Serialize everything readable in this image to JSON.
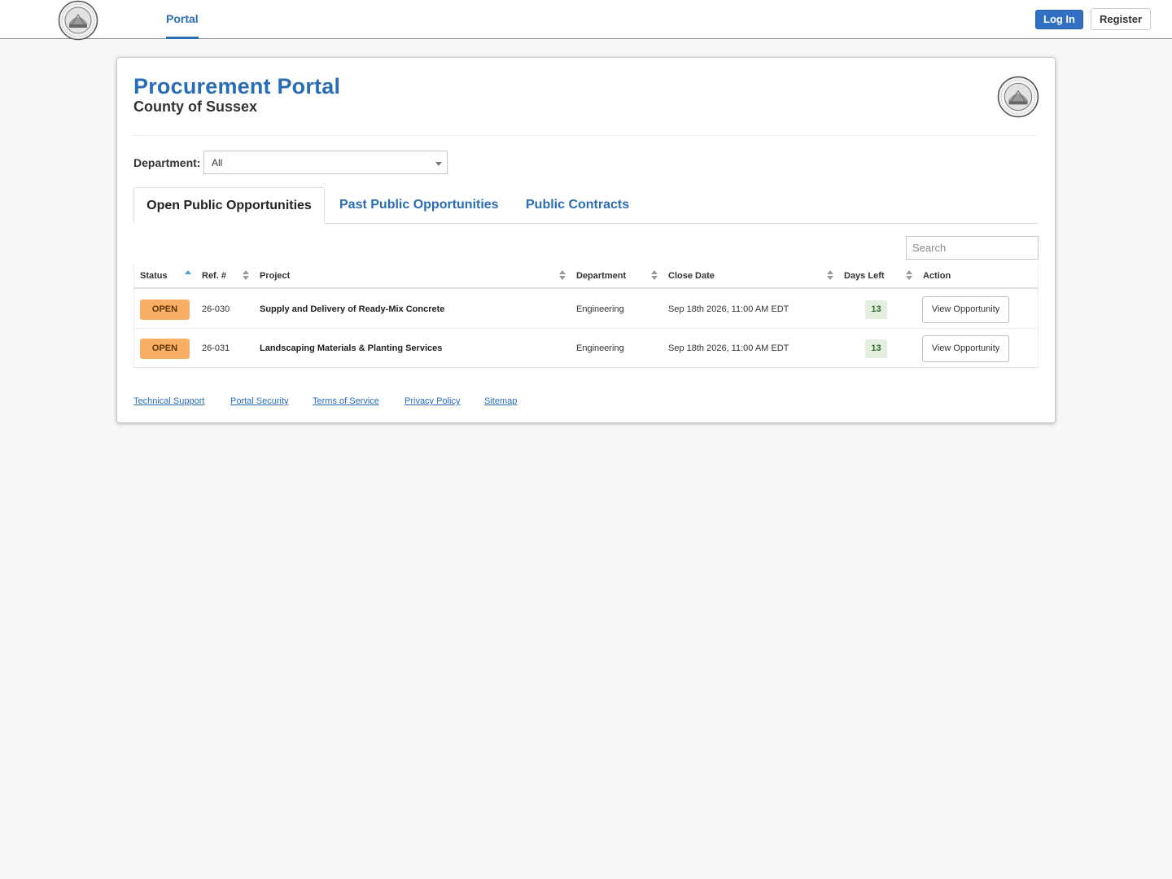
{
  "nav": {
    "logo_icon": "county-seal-icon",
    "portal_label": "Portal",
    "login_label": "Log In",
    "register_label": "Register"
  },
  "header": {
    "title": "Procurement Portal",
    "subtitle": "County of Sussex",
    "seal_icon": "county-seal-icon"
  },
  "filter": {
    "label": "Department:",
    "selected": "All"
  },
  "tabs": [
    {
      "label": "Open Public Opportunities",
      "active": true
    },
    {
      "label": "Past Public Opportunities",
      "active": false
    },
    {
      "label": "Public Contracts",
      "active": false
    }
  ],
  "search": {
    "placeholder": "Search"
  },
  "table": {
    "columns": [
      "Status",
      "Ref. #",
      "Project",
      "Department",
      "Close Date",
      "Days Left",
      "Action"
    ],
    "sorted_column": "Status",
    "rows": [
      {
        "status": "OPEN",
        "ref": "26-030",
        "project": "Supply and Delivery of Ready-Mix Concrete",
        "department": "Engineering",
        "close_date": "Sep 18th 2026, 11:00 AM EDT",
        "days_left": "13",
        "action": "View Opportunity"
      },
      {
        "status": "OPEN",
        "ref": "26-031",
        "project": "Landscaping Materials & Planting Services",
        "department": "Engineering",
        "close_date": "Sep 18th 2026, 11:00 AM EDT",
        "days_left": "13",
        "action": "View Opportunity"
      }
    ]
  },
  "footer": {
    "links": [
      "Technical Support",
      "Portal Security",
      "Terms of Service",
      "Privacy Policy",
      "Sitemap"
    ]
  },
  "colors": {
    "brand_blue": "#2a6db5",
    "login_button": "#3070c4",
    "status_open": "#f9ae65",
    "days_left_bg": "#e4f0df"
  }
}
